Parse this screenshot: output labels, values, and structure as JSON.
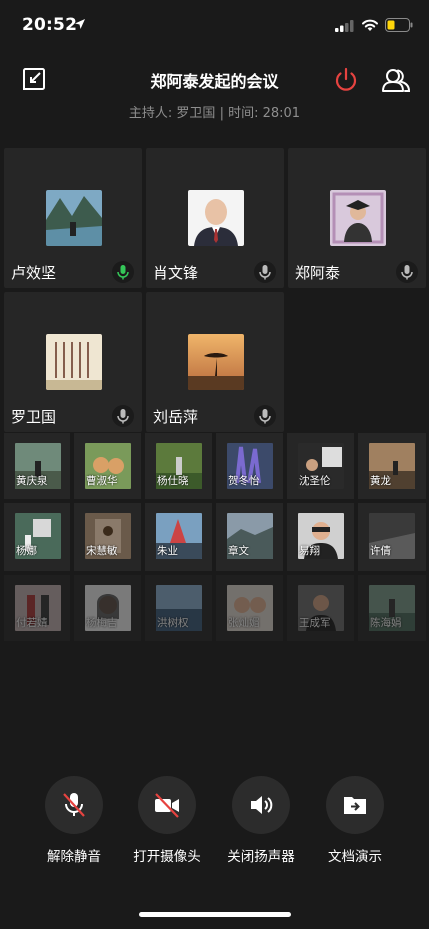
{
  "status_bar": {
    "time": "20:52"
  },
  "header": {
    "title": "郑阿泰发起的会议",
    "subtitle": "主持人: 罗卫国 | 时间: 28:01"
  },
  "colors": {
    "accent_red": "#e64340",
    "mic_green": "#35c759",
    "background": "#1a1a1a",
    "tile": "#262626",
    "battery_yellow": "#ffd60a"
  },
  "participants_large": [
    {
      "name": "卢效坚",
      "mic": "active",
      "avatar_icon": "landscape-avatar"
    },
    {
      "name": "肖文锋",
      "mic": "idle",
      "avatar_icon": "person-avatar"
    },
    {
      "name": "郑阿泰",
      "mic": "idle",
      "avatar_icon": "graduation-avatar"
    },
    {
      "name": "罗卫国",
      "mic": "idle",
      "avatar_icon": "calligraphy-avatar"
    },
    {
      "name": "刘岳萍",
      "mic": "idle",
      "avatar_icon": "sunset-avatar"
    }
  ],
  "participants_small_row1": [
    "黄庆泉",
    "曹淑华",
    "杨仕晓",
    "贺冬怡",
    "沈圣伦",
    "黄龙"
  ],
  "participants_small_row2": [
    "杨娜",
    "宋慧敏",
    "朱业",
    "章文",
    "易翔",
    "许倩"
  ],
  "participants_small_row3": [
    "付若婧",
    "杨梅吉",
    "洪树权",
    "张灿媚",
    "王成军",
    "陈海娟"
  ],
  "controls": [
    {
      "label": "解除静音",
      "icon": "mic-muted-icon"
    },
    {
      "label": "打开摄像头",
      "icon": "camera-off-icon"
    },
    {
      "label": "关闭扬声器",
      "icon": "speaker-icon"
    },
    {
      "label": "文档演示",
      "icon": "share-doc-icon"
    }
  ]
}
